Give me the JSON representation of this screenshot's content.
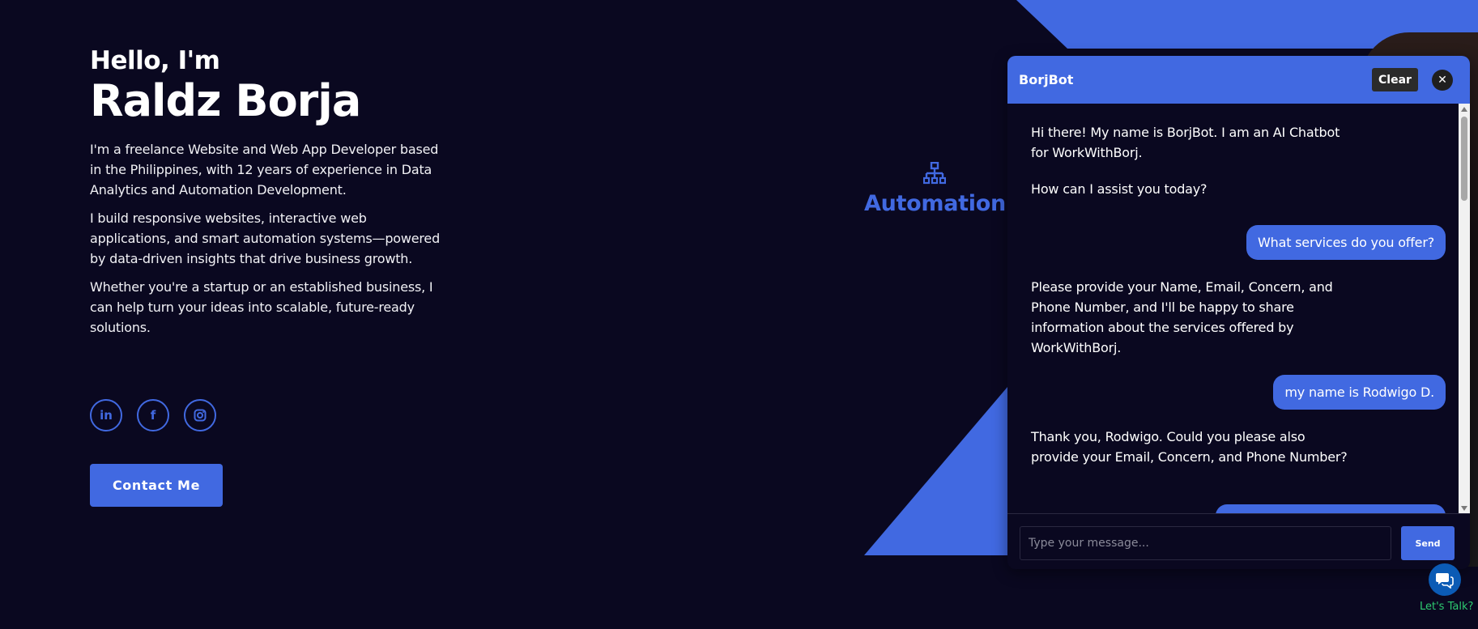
{
  "hero": {
    "greeting": "Hello, I'm",
    "name": "Raldz Borja",
    "paragraphs": [
      "I'm a freelance Website and Web App Developer based in the Philippines, with 12 years of experience in Data Analytics and Automation Development.",
      "I build responsive websites, interactive web applications, and smart automation systems—powered by data-driven insights that drive business growth.",
      "Whether you're a startup or an established business, I can help turn your ideas into scalable, future-ready solutions."
    ],
    "contact_label": "Contact Me",
    "social": [
      {
        "icon": "linkedin-icon",
        "glyph": "in"
      },
      {
        "icon": "facebook-icon",
        "glyph": "f"
      },
      {
        "icon": "instagram-icon",
        "glyph": "◎"
      }
    ]
  },
  "floating_label": {
    "icon": "network-hierarchy-icon",
    "text": "Automation"
  },
  "chat": {
    "title": "BorjBot",
    "clear_label": "Clear",
    "close_icon": "close-icon",
    "messages": [
      {
        "from": "bot",
        "text": "Hi there! My name is BorjBot. I am an AI Chatbot for WorkWithBorj."
      },
      {
        "from": "bot",
        "text": "How can I assist you today?"
      },
      {
        "from": "user",
        "text": "What services do you offer?"
      },
      {
        "from": "bot",
        "text": "Please provide your Name, Email, Concern, and Phone Number, and I'll be happy to share information about the services offered by WorkWithBorj."
      },
      {
        "from": "user",
        "text": "my name is Rodwigo D."
      },
      {
        "from": "bot",
        "text": "Thank you, Rodwigo. Could you please also provide your Email, Concern, and Phone Number?"
      },
      {
        "from": "user",
        "text": ""
      }
    ],
    "input_placeholder": "Type your message...",
    "input_value": "",
    "send_label": "Send"
  },
  "launcher": {
    "icon": "chat-bubbles-icon",
    "label": "Let's Talk?"
  },
  "colors": {
    "background": "#0a0820",
    "accent": "#4169e1",
    "success_text": "#2ecc71",
    "launcher": "#0b5bb5"
  }
}
